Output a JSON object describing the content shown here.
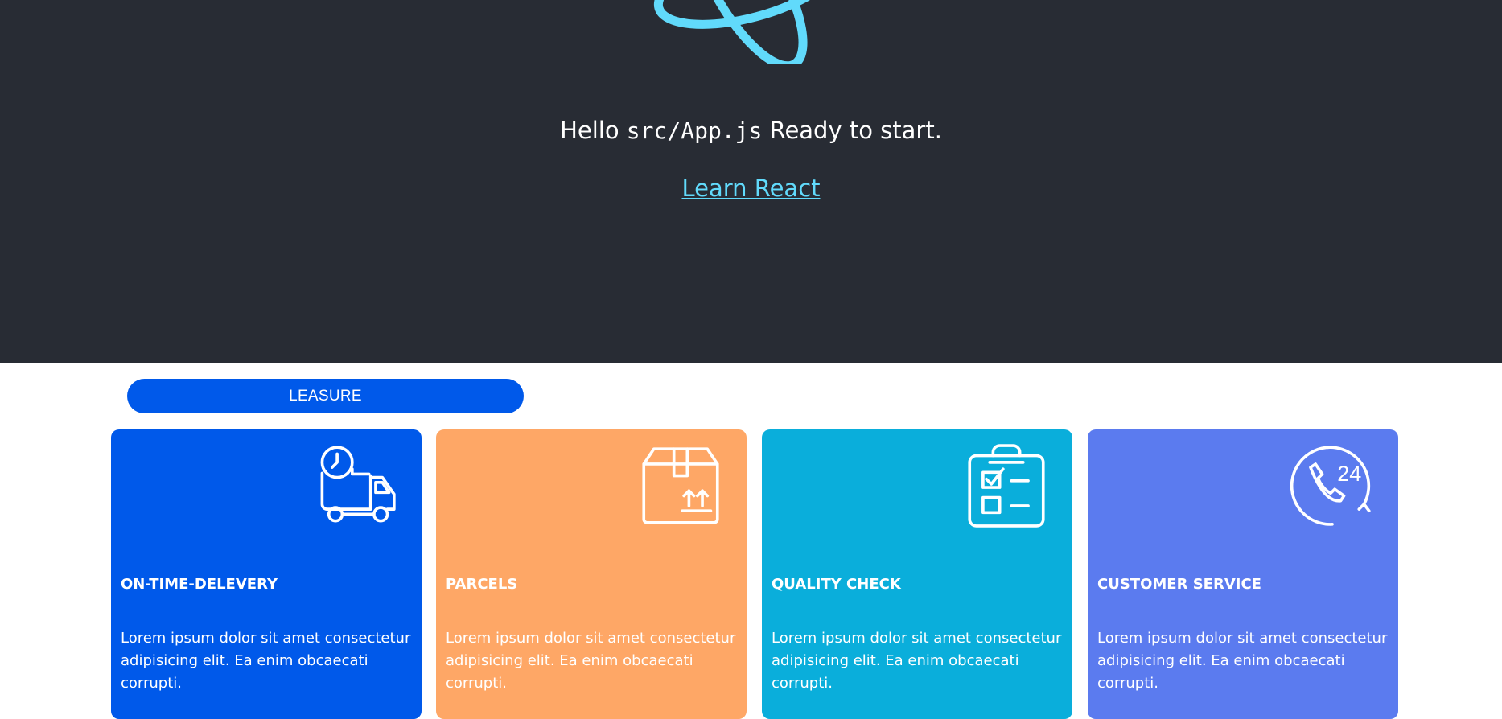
{
  "header": {
    "hello_prefix": "Hello",
    "hello_code": "src/App.js",
    "hello_suffix": "Ready to start.",
    "learn_link": "Learn React"
  },
  "colors": {
    "header_bg": "#282c34",
    "react_blue": "#61dafb",
    "pill_blue": "#0059ea"
  },
  "pill": {
    "label": "LEASURE"
  },
  "cards": [
    {
      "title": "ON-TIME-DELEVERY",
      "text": "Lorem ipsum dolor sit amet consectetur adipisicing elit. Ea enim obcaecati corrupti.",
      "icon": "delivery-truck-clock-icon",
      "color": "#0059ea"
    },
    {
      "title": "PARCELS",
      "text": "Lorem ipsum dolor sit amet consectetur adipisicing elit. Ea enim obcaecati corrupti.",
      "icon": "parcel-box-icon",
      "color": "#fea766"
    },
    {
      "title": "QUALITY CHECK",
      "text": "Lorem ipsum dolor sit amet consectetur adipisicing elit. Ea enim obcaecati corrupti.",
      "icon": "clipboard-checklist-icon",
      "color": "#0aaedb"
    },
    {
      "title": "CUSTOMER SERVICE",
      "text": "Lorem ipsum dolor sit amet consectetur adipisicing elit. Ea enim obcaecati corrupti.",
      "icon": "phone-24-icon",
      "color": "#5b7bef"
    }
  ]
}
